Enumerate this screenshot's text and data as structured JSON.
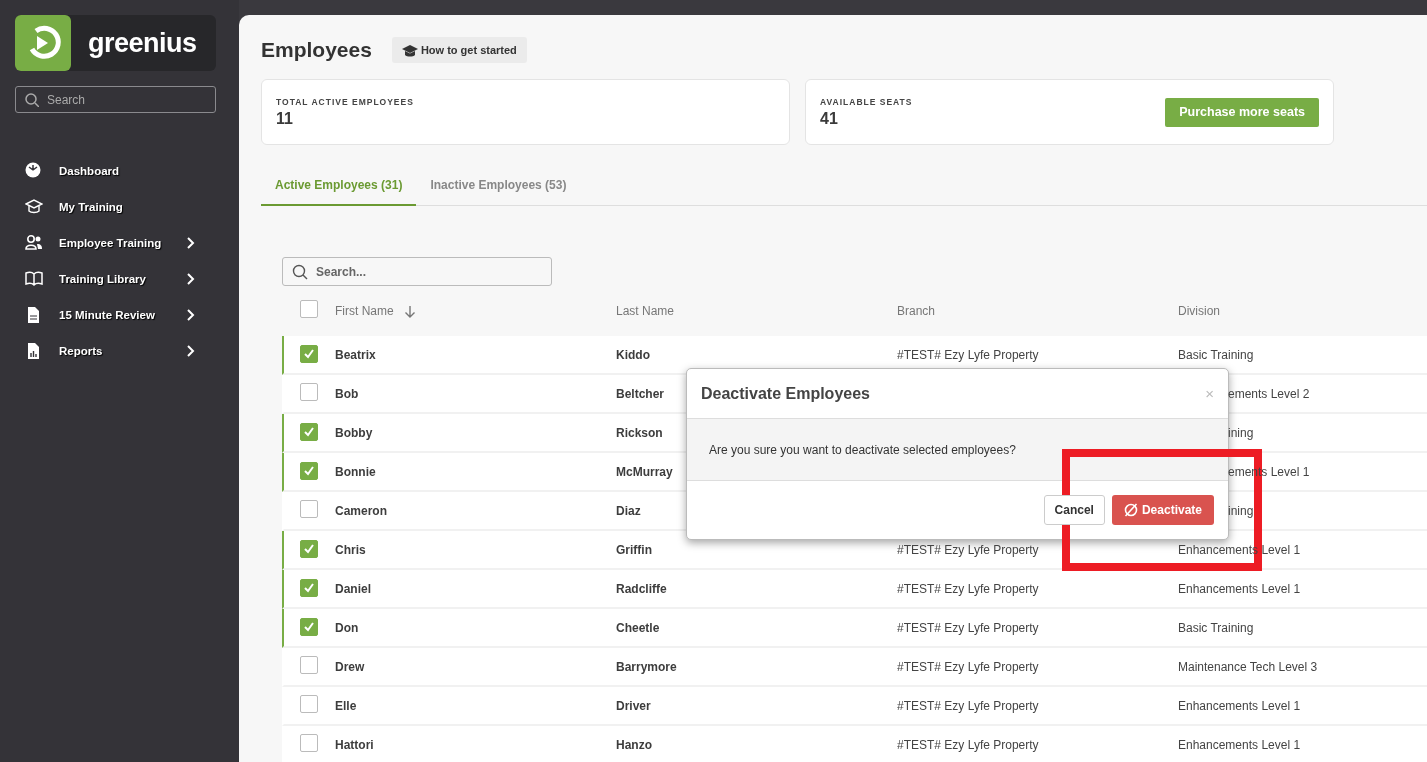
{
  "sidebar": {
    "logo_text": "greenius",
    "search": {
      "placeholder": "Search"
    },
    "items": [
      {
        "label": "Dashboard",
        "expandable": false
      },
      {
        "label": "My Training",
        "expandable": false
      },
      {
        "label": "Employee Training",
        "expandable": true
      },
      {
        "label": "Training Library",
        "expandable": true
      },
      {
        "label": "15 Minute Review",
        "expandable": true
      },
      {
        "label": "Reports",
        "expandable": true
      }
    ]
  },
  "page": {
    "title": "Employees",
    "help_button": "How to get started"
  },
  "stats": [
    {
      "label": "TOTAL ACTIVE EMPLOYEES",
      "value": "11"
    },
    {
      "label": "AVAILABLE SEATS",
      "value": "41",
      "action": "Purchase more seats"
    }
  ],
  "tabs": [
    {
      "label": "Active Employees (31)",
      "selected": true
    },
    {
      "label": "Inactive Employees (53)",
      "selected": false
    }
  ],
  "table": {
    "search": {
      "placeholder": "Search..."
    },
    "all_checked": false,
    "columns": [
      {
        "label": "First Name",
        "sorted": true
      },
      {
        "label": "Last Name",
        "sorted": false
      },
      {
        "label": "Branch",
        "sorted": false
      },
      {
        "label": "Division",
        "sorted": false
      }
    ],
    "rows": [
      {
        "first": "Beatrix",
        "last": "Kiddo",
        "branch": "#TEST# Ezy Lyfe Property",
        "division": "Basic Training",
        "checked": true,
        "covered": false
      },
      {
        "first": "Bob",
        "last": "Beltcher",
        "division": "ements Level 2",
        "checked": false,
        "covered": true
      },
      {
        "first": "Bobby",
        "last": "Rickson",
        "division": "ining",
        "checked": true,
        "covered": true
      },
      {
        "first": "Bonnie",
        "last": "McMurray",
        "division": "ements Level 1",
        "checked": true,
        "covered": true
      },
      {
        "first": "Cameron",
        "last": "Diaz",
        "division": "ining",
        "checked": false,
        "covered": true
      },
      {
        "first": "Chris",
        "last": "Griffin",
        "branch": "#TEST# Ezy Lyfe Property",
        "division": "Enhancements Level 1",
        "checked": true,
        "covered": false
      },
      {
        "first": "Daniel",
        "last": "Radcliffe",
        "branch": "#TEST# Ezy Lyfe Property",
        "division": "Enhancements Level 1",
        "checked": true,
        "covered": false
      },
      {
        "first": "Don",
        "last": "Cheetle",
        "branch": "#TEST# Ezy Lyfe Property",
        "division": "Basic Training",
        "checked": true,
        "covered": false
      },
      {
        "first": "Drew",
        "last": "Barrymore",
        "branch": "#TEST# Ezy Lyfe Property",
        "division": "Maintenance Tech Level 3",
        "checked": false,
        "covered": false
      },
      {
        "first": "Elle",
        "last": "Driver",
        "branch": "#TEST# Ezy Lyfe Property",
        "division": "Enhancements Level 1",
        "checked": false,
        "covered": false
      },
      {
        "first": "Hattori",
        "last": "Hanzo",
        "branch": "#TEST# Ezy Lyfe Property",
        "division": "Enhancements Level 1",
        "checked": false,
        "covered": false
      }
    ]
  },
  "dialog": {
    "title": "Deactivate Employees",
    "close": "×",
    "message": "Are you sure you want to deactivate selected employees?",
    "cancel": "Cancel",
    "confirm": "Deactivate"
  },
  "annotation": {
    "kind": "frame"
  }
}
